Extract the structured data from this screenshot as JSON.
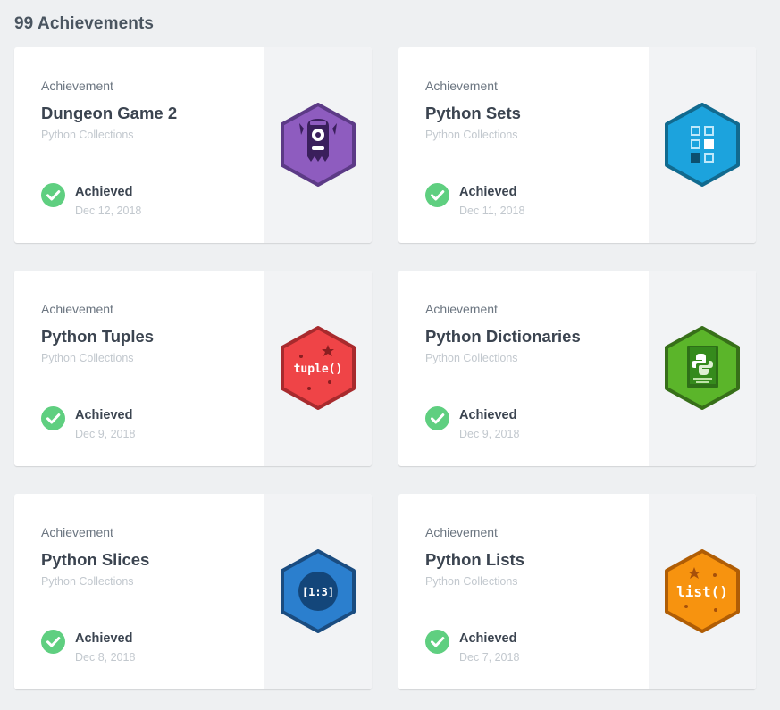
{
  "header": {
    "title": "99 Achievements"
  },
  "achievements": [
    {
      "type": "Achievement",
      "title": "Dungeon Game 2",
      "course": "Python Collections",
      "status": "Achieved",
      "date": "Dec 12, 2018",
      "badge_icon": "monster-icon",
      "badge_color": "#8e5cbf",
      "badge_border": "#5c3a86"
    },
    {
      "type": "Achievement",
      "title": "Python Sets",
      "course": "Python Collections",
      "status": "Achieved",
      "date": "Dec 11, 2018",
      "badge_icon": "grid-squares-icon",
      "badge_color": "#1ca3dd",
      "badge_border": "#116a8f"
    },
    {
      "type": "Achievement",
      "title": "Python Tuples",
      "course": "Python Collections",
      "status": "Achieved",
      "date": "Dec 9, 2018",
      "badge_icon": "tuple-icon",
      "badge_text": "tuple()",
      "badge_color": "#ef4447",
      "badge_border": "#a82a2d"
    },
    {
      "type": "Achievement",
      "title": "Python Dictionaries",
      "course": "Python Collections",
      "status": "Achieved",
      "date": "Dec 9, 2018",
      "badge_icon": "python-book-icon",
      "badge_color": "#5bb52a",
      "badge_border": "#376f19"
    },
    {
      "type": "Achievement",
      "title": "Python Slices",
      "course": "Python Collections",
      "status": "Achieved",
      "date": "Dec 8, 2018",
      "badge_icon": "slice-icon",
      "badge_text": "[1:3]",
      "badge_color": "#2b7fce",
      "badge_border": "#1a4c80"
    },
    {
      "type": "Achievement",
      "title": "Python Lists",
      "course": "Python Collections",
      "status": "Achieved",
      "date": "Dec 7, 2018",
      "badge_icon": "list-icon",
      "badge_text": "list()",
      "badge_color": "#f7930f",
      "badge_border": "#b05d05"
    }
  ],
  "colors": {
    "check": "#5fcf80",
    "background": "#eef0f2"
  }
}
